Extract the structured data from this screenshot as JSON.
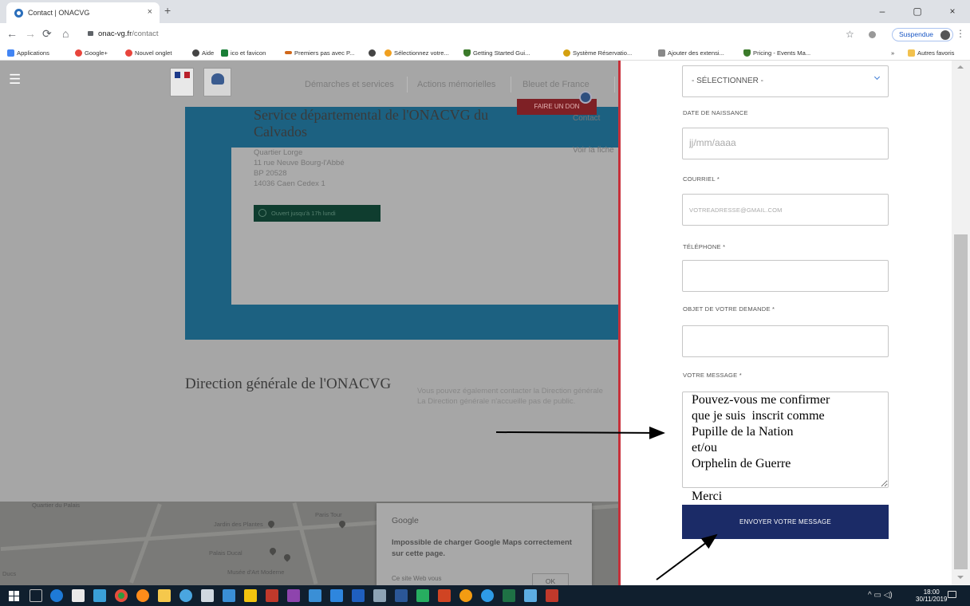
{
  "browser": {
    "tab_title": "Contact | ONACVG",
    "tab_close": "×",
    "new_tab": "+",
    "url_host": "onac-vg.fr",
    "url_path": "/contact",
    "profile_label": "Suspendue",
    "window_minimize": "–",
    "window_maximize": "▢",
    "window_close": "×",
    "bookmarks": [
      {
        "label": "Applications",
        "color": "#4285f4"
      },
      {
        "label": "Google+",
        "color": "#e8453c"
      },
      {
        "label": "Nouvel onglet",
        "color": "#e8453c"
      },
      {
        "label": "Aide",
        "color": "#444444"
      },
      {
        "label": "ico et favicon",
        "color": "#1a7f37"
      },
      {
        "label": "Premiers pas avec P...",
        "color": "#d0681a"
      },
      {
        "label": "",
        "color": "#444444"
      },
      {
        "label": "Sélectionnez votre...",
        "color": "#f0a020"
      },
      {
        "label": "Getting Started Gui...",
        "color": "#3b7a2a"
      },
      {
        "label": "Système Réservatio...",
        "color": "#d4a010"
      },
      {
        "label": "Ajouter des extensi...",
        "color": "#888888"
      },
      {
        "label": "Pricing - Events Ma...",
        "color": "#3b7a2a"
      }
    ],
    "bookmarks_more": "»",
    "other_bookmarks": "Autres favoris"
  },
  "site": {
    "nav": [
      "Démarches et services",
      "Actions mémorielles",
      "Bleuet de France"
    ],
    "donate_label": "FAIRE UN DON",
    "office": {
      "title": "Service départemental de l'ONACVG du Calvados",
      "address_lines": [
        "Quartier Lorge",
        "11 rue Neuve Bourg-l'Abbé",
        "BP 20528",
        "14036 Caen Cedex 1"
      ],
      "open_badge": "Ouvert jusqu'à 17h lundi",
      "contact_link": "Contact",
      "voir_link": "Voir la fiche"
    },
    "direction": {
      "title": "Direction générale de l'ONACVG",
      "text_1": "Vous pouvez également contacter la Direction générale",
      "text_2": "La Direction générale n'accueille pas de public."
    },
    "map": {
      "labels": [
        "Quartier du Palais",
        "Jardin des Plantes",
        "Palais Ducal",
        "Musée d'Art Moderne",
        "Paris Tour",
        "Ducs"
      ],
      "error_title": "Google",
      "error_message": "Impossible de charger Google Maps correctement sur cette page.",
      "error_sub": "Ce site Web vous",
      "ok_label": "OK"
    }
  },
  "form": {
    "select_value": "- SÉLECTIONNER -",
    "birthdate_label": "DATE DE NAISSANCE",
    "birthdate_placeholder": "jj/mm/aaaa",
    "email_label": "COURRIEL *",
    "email_placeholder": "VOTREADRESSE@GMAIL.COM",
    "phone_label": "TÉLÉPHONE *",
    "subject_label": "OBJET DE VOTRE DEMANDE *",
    "message_label": "VOTRE MESSAGE *",
    "message_value": "Pouvez-vous me confirmer\nque je suis  inscrit comme\nPupille de la Nation\net/ou\nOrphelin de Guerre",
    "merci": "Merci",
    "submit_label": "ENVOYER VOTRE MESSAGE"
  },
  "taskbar": {
    "time": "18:00",
    "date": "30/11/2019"
  },
  "colors": {
    "accent_red": "#c8303a",
    "button_navy": "#1b2b67",
    "band_blue": "#1c6181"
  }
}
